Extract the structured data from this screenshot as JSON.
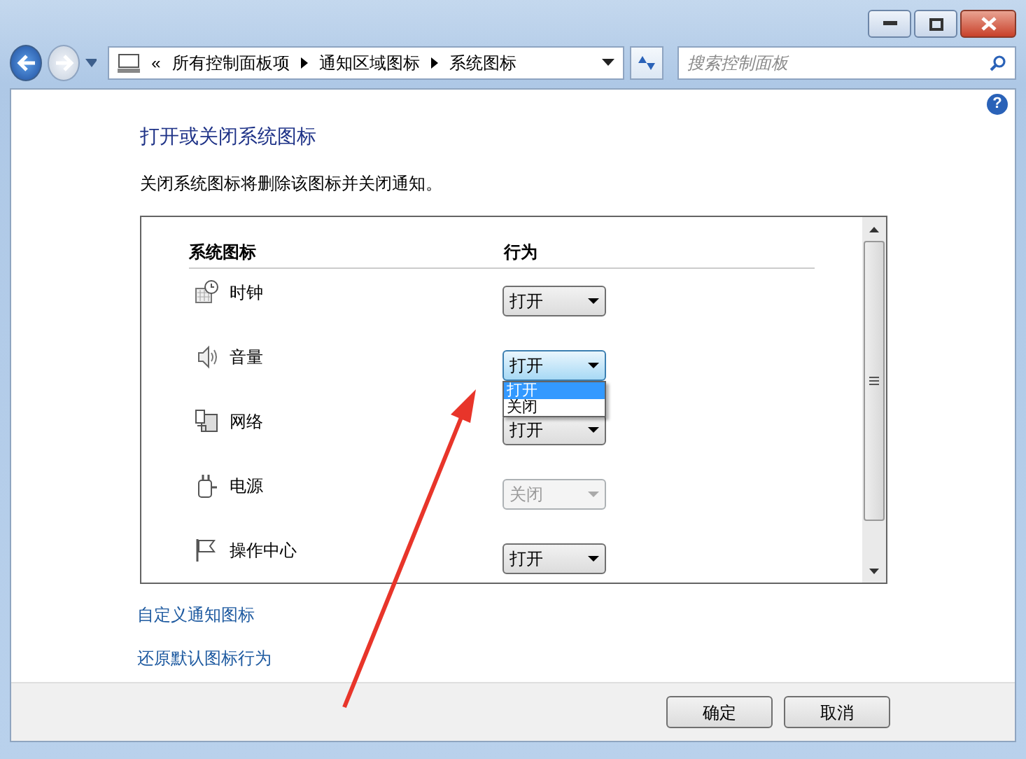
{
  "address_bar": {
    "overflow": "«",
    "crumbs": [
      "所有控制面板项",
      "通知区域图标",
      "系统图标"
    ]
  },
  "search": {
    "placeholder": "搜索控制面板"
  },
  "help": "?",
  "heading": "打开或关闭系统图标",
  "description": "关闭系统图标将删除该图标并关闭通知。",
  "columns": [
    "系统图标",
    "行为"
  ],
  "rows": [
    {
      "kind": "clock",
      "name": "时钟",
      "behavior": "打开",
      "disabled": false,
      "open": false
    },
    {
      "kind": "volume",
      "name": "音量",
      "behavior": "打开",
      "disabled": false,
      "open": true
    },
    {
      "kind": "network",
      "name": "网络",
      "behavior": "打开",
      "disabled": false,
      "open": false
    },
    {
      "kind": "power",
      "name": "电源",
      "behavior": "关闭",
      "disabled": true,
      "open": false
    },
    {
      "kind": "flag",
      "name": "操作中心",
      "behavior": "打开",
      "disabled": false,
      "open": false
    }
  ],
  "dropdown_options": [
    {
      "label": "打开",
      "selected": true
    },
    {
      "label": "关闭",
      "selected": false
    }
  ],
  "links": [
    "自定义通知图标",
    "还原默认图标行为"
  ],
  "buttons": [
    "确定",
    "取消"
  ]
}
